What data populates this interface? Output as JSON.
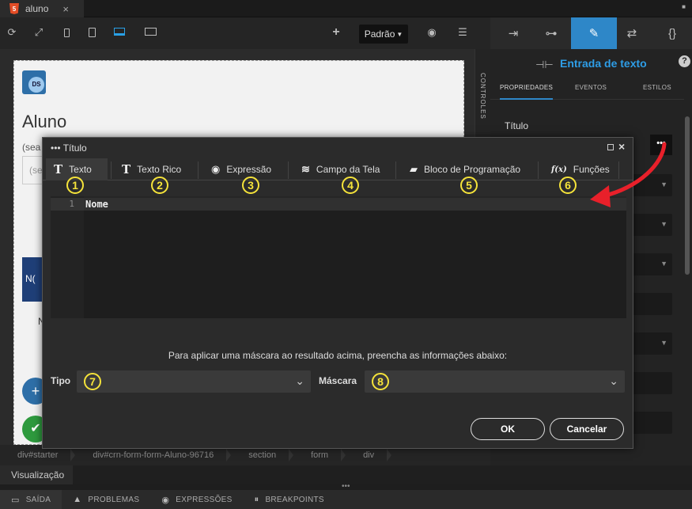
{
  "file_tab": {
    "name": "aluno",
    "close": "×",
    "icon": "html5-icon"
  },
  "toolbar": {
    "device_selector": "Padrão"
  },
  "right_panel": {
    "header_title": "Entrada de texto",
    "help": "?",
    "subtabs": [
      "PROPRIEDADES",
      "EVENTOS",
      "ESTILOS"
    ],
    "field_label": "Título",
    "dots": "•••"
  },
  "canvas": {
    "logo": "DS",
    "title": "Aluno",
    "seal": "(sea",
    "input_text": "(se",
    "nav_text": "N(",
    "row_text": "N",
    "side_label": "CONTROLES"
  },
  "dialog": {
    "title": "••• Título",
    "tabs": [
      {
        "label": "Texto",
        "badge": "1"
      },
      {
        "label": "Texto Rico",
        "badge": "2"
      },
      {
        "label": "Expressão",
        "badge": "3"
      },
      {
        "label": "Campo da Tela",
        "badge": "4"
      },
      {
        "label": "Bloco de Programação",
        "badge": "5"
      },
      {
        "label": "Funções",
        "badge": "6"
      }
    ],
    "editor": {
      "line_number": "1",
      "content": "Nome"
    },
    "mask_info": "Para aplicar uma máscara ao resultado acima, preencha as informações abaixo:",
    "tipo_label": "Tipo",
    "tipo_badge": "7",
    "mascara_label": "Máscara",
    "mascara_badge": "8",
    "ok": "OK",
    "cancel": "Cancelar"
  },
  "breadcrumbs": [
    "div#starter",
    "div#crn-form-form-Aluno-96716",
    "section",
    "form",
    "div"
  ],
  "view_tab": "Visualização",
  "status": [
    {
      "label": "SAÍDA",
      "icon": "output-icon"
    },
    {
      "label": "PROBLEMAS",
      "icon": "warning-icon"
    },
    {
      "label": "EXPRESSÕES",
      "icon": "eye-icon"
    },
    {
      "label": "BREAKPOINTS",
      "icon": "pause-icon"
    }
  ],
  "colors": {
    "accent": "#2e87c8",
    "badge": "#f5e33a",
    "arrow": "#e8202a"
  }
}
